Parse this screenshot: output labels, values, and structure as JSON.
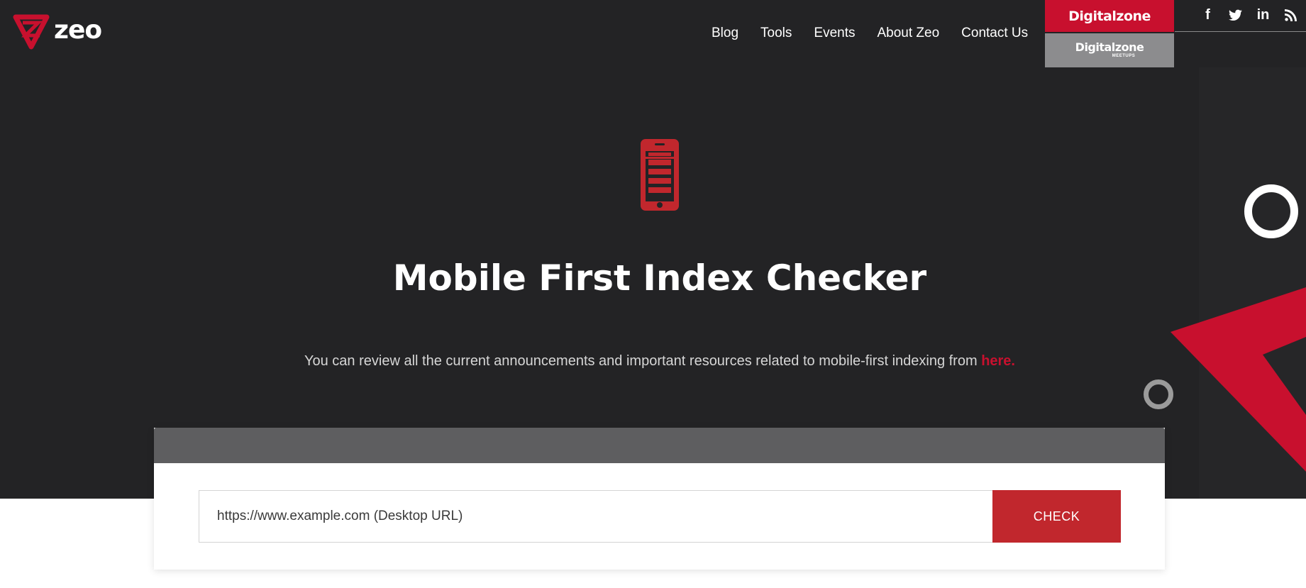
{
  "header": {
    "logo_text": "zeo",
    "nav": [
      "Blog",
      "Tools",
      "Events",
      "About Zeo",
      "Contact Us"
    ],
    "digitalzone_label": "Digitalzone",
    "digitalzone_meetups_label": "Digitalzone",
    "digitalzone_meetups_sub": "MEETUPS",
    "social_icons": [
      "facebook-icon",
      "twitter-icon",
      "linkedin-icon",
      "rss-icon"
    ],
    "social_glyphs": {
      "facebook": "f",
      "twitter": "t",
      "linkedin": "in",
      "rss": "≋"
    }
  },
  "hero": {
    "title": "Mobile First Index Checker",
    "description": "You can review all the current announcements and important resources related to mobile-first indexing from ",
    "link_text": "here."
  },
  "form": {
    "url_placeholder": "https://www.example.com (Desktop URL)",
    "check_label": "CHECK"
  },
  "colors": {
    "brand_red": "#c8102e",
    "dark_bg": "#232325",
    "card_header": "#5e5e60",
    "button": "#c1272d"
  }
}
